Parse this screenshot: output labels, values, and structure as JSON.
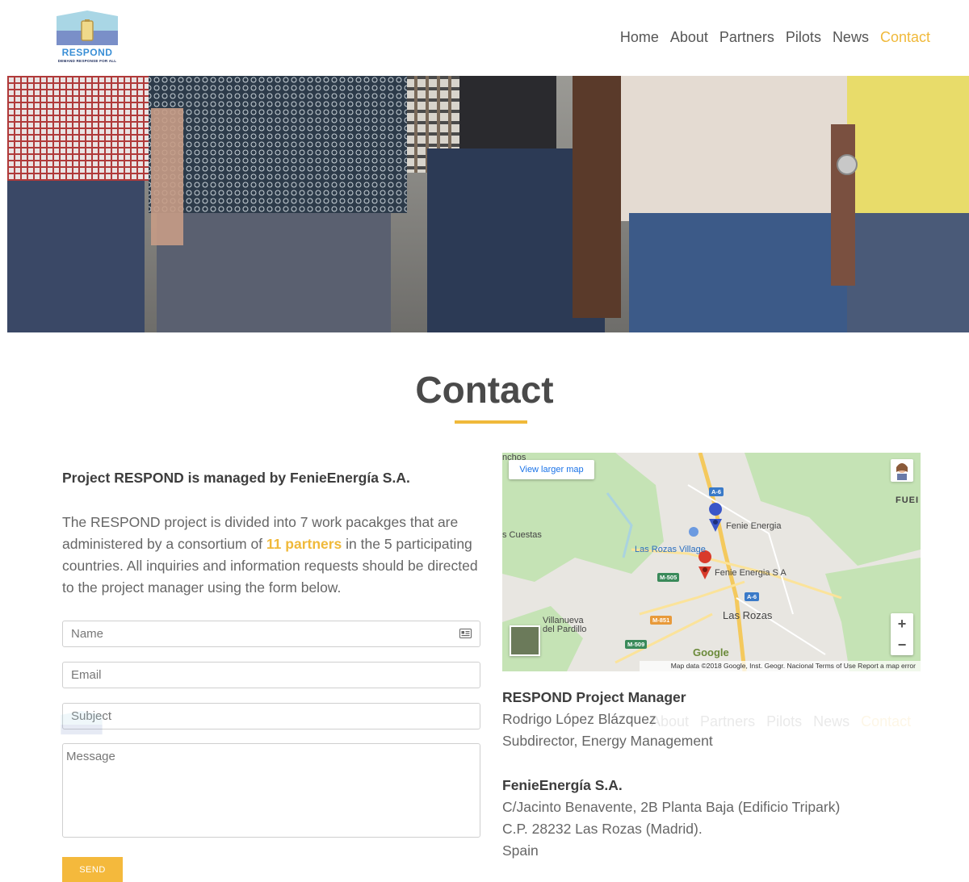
{
  "header": {
    "logo_text": "RESPOND",
    "logo_tagline": "DEMAND RESPONSE FOR ALL",
    "nav": [
      {
        "label": "Home"
      },
      {
        "label": "About"
      },
      {
        "label": "Partners"
      },
      {
        "label": "Pilots"
      },
      {
        "label": "News"
      },
      {
        "label": "Contact"
      }
    ],
    "active_color": "#f0b93a"
  },
  "page": {
    "title": "Contact",
    "accent": "#f0b93a"
  },
  "intro": {
    "heading": "Project RESPOND is managed by FenieEnergía S.A.",
    "text_before": "The RESPOND project is divided into 7 work pacakges that are administered by a consortium of ",
    "highlight": "11 partners",
    "text_after": " in the 5 participating countries. All inquiries and information requests should be directed to the project manager using the form below."
  },
  "form": {
    "name_placeholder": "Name",
    "email_placeholder": "Email",
    "subject_placeholder": "Subject",
    "message_placeholder": "Message",
    "send_label": "SEND",
    "send_color": "#f4b93c",
    "name_icon": "contact-card-icon"
  },
  "map": {
    "view_larger": "View larger map",
    "labels": {
      "top_left": "nchos",
      "cuestas": "s Cuestas",
      "fue": "FUEI",
      "rozas_village": "Las Rozas Village",
      "fenie1": "Fenie Energia",
      "fenie2": "Fenie Energia S A",
      "las_rozas": "Las Rozas",
      "villanueva1": "Villanueva",
      "villanueva2": "del Pardillo"
    },
    "roads": [
      "A-6",
      "A-6",
      "M-505",
      "M-851",
      "M-509"
    ],
    "google": "Google",
    "footer": "Map data ©2018 Google, Inst. Geogr. Nacional    Terms of Use    Report a map error",
    "zoom_in": "+",
    "zoom_out": "−"
  },
  "manager": {
    "heading": "RESPOND Project Manager",
    "name": "Rodrigo López Blázquez",
    "role": "Subdirector, Energy Management"
  },
  "company": {
    "heading": "FenieEnergía S.A.",
    "address1": "C/Jacinto Benavente, 2B Planta Baja (Edificio Tripark)",
    "address2": "C.P. 28232 Las Rozas (Madrid).",
    "country": "Spain"
  }
}
